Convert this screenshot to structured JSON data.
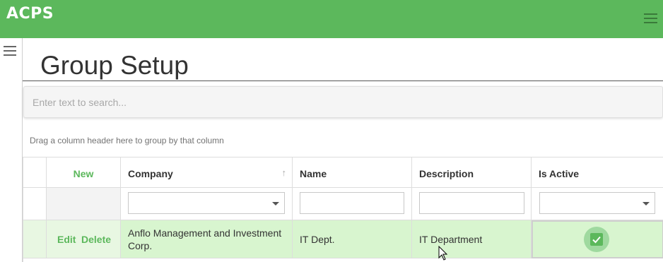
{
  "app": {
    "title": "ACPS"
  },
  "page": {
    "title": "Group Setup"
  },
  "search": {
    "placeholder": "Enter text to search..."
  },
  "grid": {
    "group_panel_text": "Drag a column header here to group by that column",
    "new_label": "New",
    "columns": [
      "Company",
      "Name",
      "Description",
      "Is Active"
    ],
    "sorted_column": "Company",
    "sort_direction": "ascending",
    "rows": [
      {
        "company": "Anflo Management and Investment Corp.",
        "name": "IT Dept.",
        "description": "IT Department",
        "is_active": true,
        "edit_label": "Edit",
        "delete_label": "Delete"
      }
    ]
  },
  "icons": {
    "menu": "hamburger-icon",
    "sort": "sort-ascending-icon",
    "dropdown": "chevron-down-icon",
    "check": "checkmark-icon"
  },
  "colors": {
    "brand": "#5cb85c",
    "selected_row": "#d8f5cf"
  }
}
